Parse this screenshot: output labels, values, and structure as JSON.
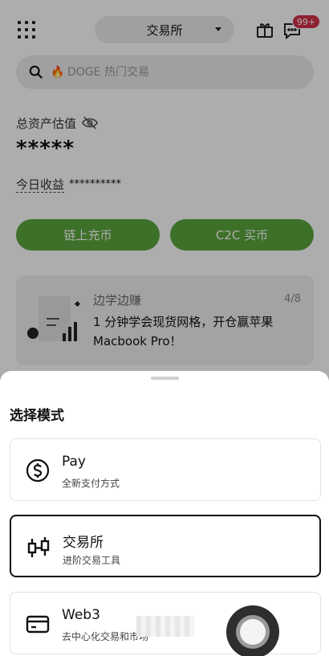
{
  "header": {
    "mode_label": "交易所",
    "badge": "99+"
  },
  "search": {
    "icon_emoji": "🔥",
    "placeholder": "DOGE 热门交易"
  },
  "assets": {
    "label": "总资产估值",
    "value": "*****",
    "today_label": "今日收益",
    "today_value": "**********"
  },
  "actions": {
    "deposit_label": "链上充币",
    "c2c_label": "C2C 买币"
  },
  "promo": {
    "title": "边学边赚",
    "count": "4/8",
    "text": "1 分钟学会现货网格，开仓赢苹果 Macbook Pro！"
  },
  "sheet": {
    "title": "选择模式",
    "options": [
      {
        "title": "Pay",
        "subtitle": "全新支付方式",
        "icon": "dollar-circle-icon"
      },
      {
        "title": "交易所",
        "subtitle": "进阶交易工具",
        "icon": "candlestick-icon"
      },
      {
        "title": "Web3",
        "subtitle": "去中心化交易和市场",
        "icon": "card-icon"
      }
    ],
    "selected_index": 1
  },
  "colors": {
    "accent_green": "#5aa53d",
    "badge_red": "#d3304a"
  }
}
